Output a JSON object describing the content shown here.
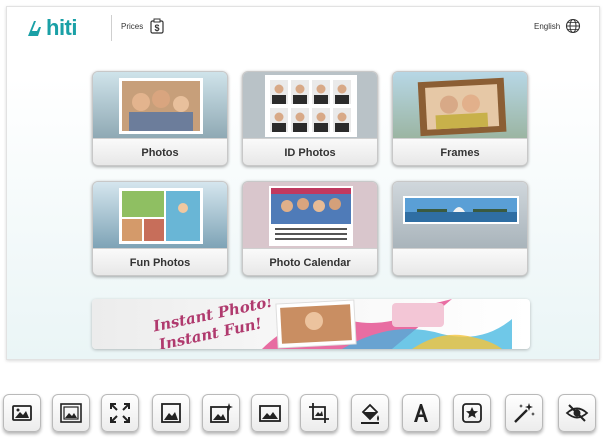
{
  "header": {
    "brand": "hiti",
    "prices_label": "Prices",
    "language_label": "English"
  },
  "tiles": [
    {
      "label": "Photos",
      "icon": "photos-tile"
    },
    {
      "label": "ID Photos",
      "icon": "id-photos-tile"
    },
    {
      "label": "Frames",
      "icon": "frames-tile"
    },
    {
      "label": "Fun Photos",
      "icon": "fun-photos-tile"
    },
    {
      "label": "Photo Calendar",
      "icon": "photo-calendar-tile"
    },
    {
      "label": "",
      "icon": "panorama-tile"
    }
  ],
  "banner": {
    "line1": "Instant Photo!",
    "line2": "Instant Fun!"
  },
  "toolbar": [
    "image-icon",
    "image-framed-icon",
    "expand-icon",
    "image-square-icon",
    "image-sparkle-icon",
    "image-plain-icon",
    "crop-icon",
    "paint-bucket-icon",
    "text-icon",
    "sticker-star-icon",
    "magic-wand-icon",
    "eye-hidden-icon"
  ],
  "colors": {
    "brand": "#1aa0a6",
    "tile_label_text": "#333333"
  }
}
